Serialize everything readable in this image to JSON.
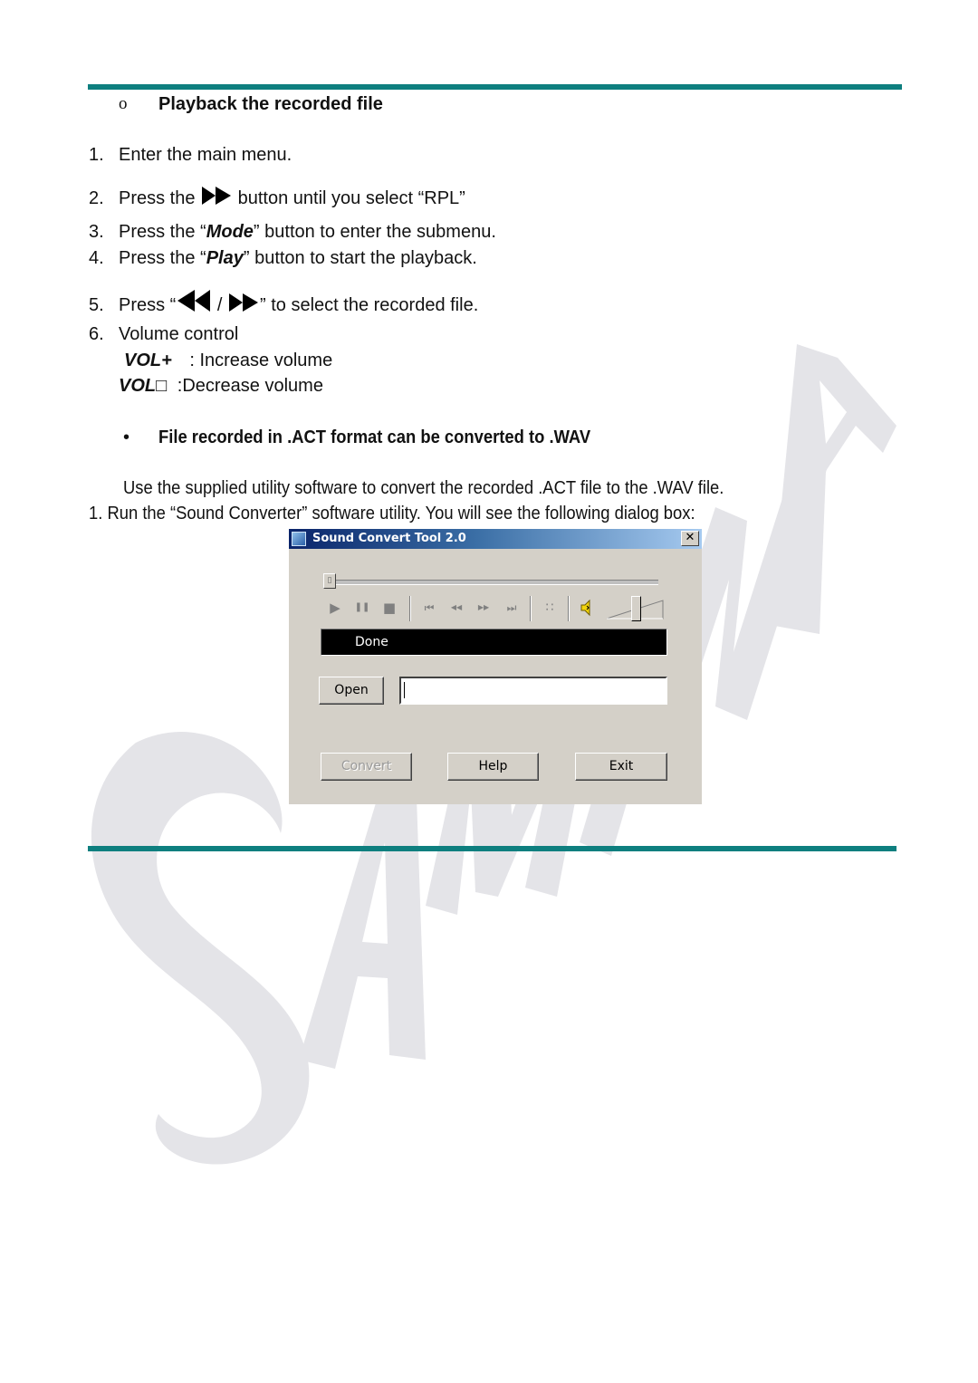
{
  "watermark": {
    "text": "AMAINA",
    "color": "#e4e4e8"
  },
  "accent_color": "#0e7f7f",
  "section1": {
    "bullet": "o",
    "heading": "Playback the recorded file",
    "steps": [
      {
        "num": "1.",
        "text": "Enter the main menu."
      },
      {
        "num": "2.",
        "before": "Press the ",
        "icon": "fast-forward-icon",
        "after": " button until you select “RPL”"
      },
      {
        "num": "3.",
        "before": "Press the “",
        "emph": "Mode",
        "after": "” button to enter the submenu."
      },
      {
        "num": "4.",
        "before": "Press the “",
        "emph": "Play",
        "after": "” button to start the playback."
      },
      {
        "num": "5.",
        "before": "Press “",
        "sep": " / ",
        "after": "” to select the recorded file."
      },
      {
        "num": "6.",
        "text": "Volume control"
      }
    ],
    "volume": [
      {
        "key": "VOL+",
        "desc": " : Increase volume"
      },
      {
        "key": "VOL□",
        "desc": " :Decrease volume"
      }
    ]
  },
  "section2": {
    "bullet": "•",
    "heading": "File recorded in .ACT format can be converted to .WAV",
    "intro": "Use the supplied utility software to convert the recorded .ACT file to the .WAV file.",
    "step1": "1. Run the “Sound Converter” software utility. You will see the following dialog box:"
  },
  "dialog": {
    "title": "Sound Convert Tool 2.0",
    "close_label": "✕",
    "seek_progress": 0,
    "volume_level": 0.55,
    "controls": [
      {
        "name": "play-button",
        "glyph": "▶"
      },
      {
        "name": "pause-button",
        "glyph": "❚❚"
      },
      {
        "name": "stop-button",
        "glyph": "■"
      },
      {
        "name": "skip-back-button",
        "glyph": "⏮"
      },
      {
        "name": "rewind-button",
        "glyph": "◀◀"
      },
      {
        "name": "forward-button",
        "glyph": "▶▶"
      },
      {
        "name": "skip-forward-button",
        "glyph": "⏭"
      },
      {
        "name": "playlist-button",
        "glyph": "∷"
      }
    ],
    "status_text": "Done",
    "open_label": "Open",
    "path_value": "",
    "convert_label": "Convert",
    "help_label": "Help",
    "exit_label": "Exit"
  }
}
